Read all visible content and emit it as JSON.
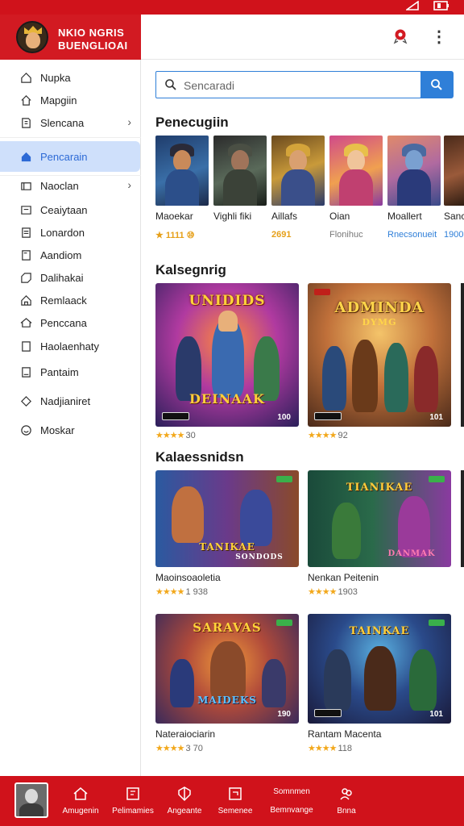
{
  "status_bar": {
    "left_icon": "signal-icon",
    "right_icon": "battery-icon"
  },
  "app": {
    "brand_line1": "NKIO NGRIS",
    "brand_line2": "BUENGLIOAI"
  },
  "sidebar": {
    "items": [
      {
        "label": "Nupka",
        "icon": "home-icon"
      },
      {
        "label": "Mapgiin",
        "icon": "house-outline-icon"
      },
      {
        "label": "Slencana",
        "icon": "bookmark-icon",
        "chevron": true
      },
      {
        "label": "Pencarain",
        "icon": "home-filled-icon",
        "active": true
      },
      {
        "label": "Naoclan",
        "icon": "folder-icon",
        "chevron": true
      },
      {
        "label": "Ceaiytaan",
        "icon": "document-icon"
      },
      {
        "label": "Lonardon",
        "icon": "list-icon"
      },
      {
        "label": "Aandiom",
        "icon": "document-icon"
      },
      {
        "label": "Dalihakai",
        "icon": "tag-icon"
      },
      {
        "label": "Remlaack",
        "icon": "home-icon"
      },
      {
        "label": "Penccana",
        "icon": "home-outline-icon"
      },
      {
        "label": "Haolaenhaty",
        "icon": "page-icon"
      },
      {
        "label": "Pantaim",
        "icon": "page-icon"
      },
      {
        "label": "Nadjianiret",
        "icon": "diamond-icon"
      },
      {
        "label": "Moskar",
        "icon": "smile-icon"
      }
    ]
  },
  "search": {
    "placeholder": "Sencaradi"
  },
  "sections": {
    "recommended": "Penecugiin",
    "categories": "Kalsegnrig",
    "new": "Kalaessnidsn"
  },
  "recommended": [
    {
      "name": "Maoekar",
      "sub": "★ 1111 ⑩",
      "sub_color": "#e6a01a"
    },
    {
      "name": "Vighli fiki",
      "sub": "",
      "sub_color": "#888"
    },
    {
      "name": "Aillafs",
      "sub": "2691",
      "sub_color": "#e6a01a"
    },
    {
      "name": "Oian",
      "sub": "Flonihuc",
      "sub_color": "#777"
    },
    {
      "name": "Moallert",
      "sub": "Rnecsonueit",
      "sub_color": "#2f7fd8"
    },
    {
      "name": "Sanc",
      "sub": "1900",
      "sub_color": "#2f7fd8"
    }
  ],
  "category_cards": [
    {
      "title": "UNIDIDS",
      "title2": "DEINAAK",
      "count": "100",
      "rating": "30"
    },
    {
      "title": "ADMINDA",
      "title2": "DYMG",
      "count": "101",
      "rating": "92"
    }
  ],
  "new_cards": [
    {
      "title": "TANIKAE",
      "title2": "SONDODS",
      "name": "Maoinsoaoletia",
      "rating": "1 938"
    },
    {
      "title": "TIANIKAE",
      "title2": "DANMAK",
      "name": "Nenkan Peitenin",
      "rating": "1903"
    },
    {
      "title": "SARAVAS",
      "title2": "MAIDEKS",
      "name": "Nateraiociarin",
      "count": "190",
      "rating": "3 70"
    },
    {
      "title": "TAINKAE",
      "title2": "",
      "name": "Rantam Macenta",
      "count": "101",
      "rating": "118"
    }
  ],
  "bottom_nav": {
    "items": [
      {
        "label": "Amugenin",
        "icon": "home-outline-icon"
      },
      {
        "label": "Pelimamies",
        "icon": "grid-icon"
      },
      {
        "label": "Angeante",
        "icon": "shield-icon"
      },
      {
        "label": "Semenee",
        "icon": "square-icon"
      },
      {
        "label": "Bemnvange",
        "sup": "Somnmen"
      },
      {
        "label": "Bnna",
        "icon": "people-icon"
      }
    ]
  },
  "colors": {
    "brand_red": "#d21a22",
    "accent_blue": "#2f7fd8",
    "star": "#f2a81c"
  }
}
